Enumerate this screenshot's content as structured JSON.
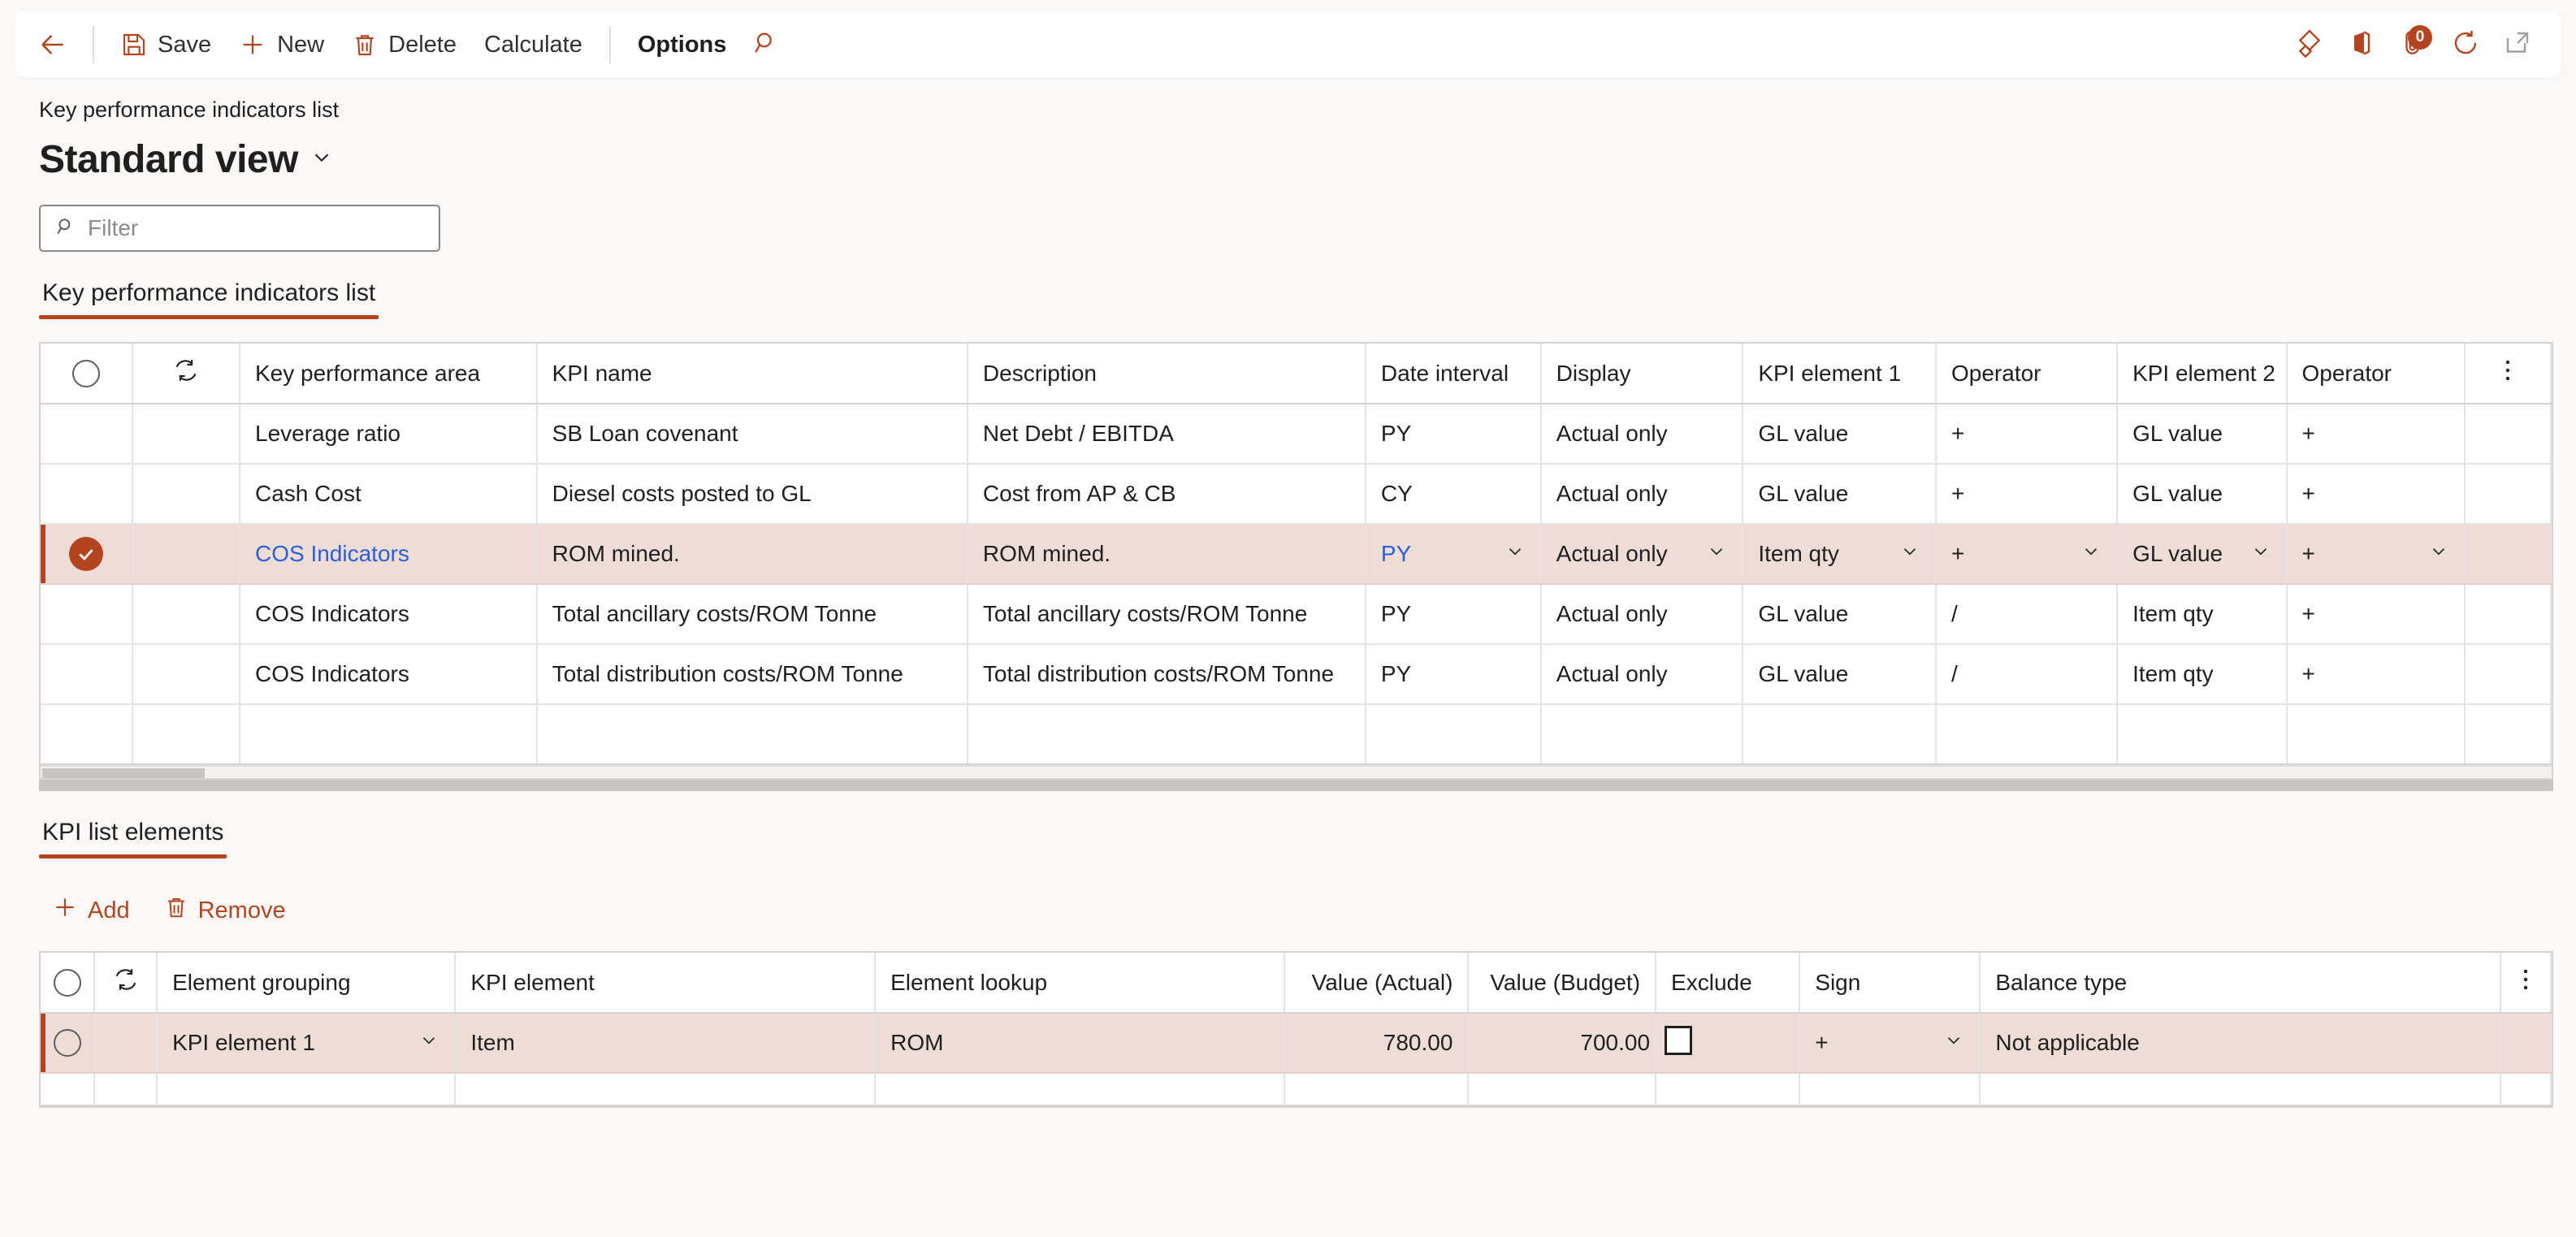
{
  "toolbar": {
    "back_label": "Back",
    "save_label": "Save",
    "new_label": "New",
    "delete_label": "Delete",
    "calculate_label": "Calculate",
    "options_label": "Options",
    "search_label": "Search",
    "icons": {
      "back": "back-arrow-icon",
      "save": "save-icon",
      "new": "plus-icon",
      "delete": "trash-icon",
      "search": "magnifier-icon",
      "diamond": "diamond-app-icon",
      "office": "office-icon",
      "attach": "paperclip-icon",
      "refresh": "refresh-icon",
      "popout": "open-in-new-window-icon"
    },
    "notification_count": "0"
  },
  "header": {
    "breadcrumb": "Key performance indicators list",
    "view_title": "Standard view"
  },
  "filter": {
    "placeholder": "Filter",
    "value": ""
  },
  "section_tabs": {
    "kpi_list": "Key performance indicators list",
    "kpi_elements": "KPI list elements"
  },
  "kpi_grid": {
    "columns": [
      "Key performance area",
      "KPI name",
      "Description",
      "Date interval",
      "Display",
      "KPI element 1",
      "Operator",
      "KPI element 2",
      "Operator"
    ],
    "rows": [
      {
        "selected": false,
        "area": "Leverage ratio",
        "name": "SB Loan covenant",
        "description": "Net Debt / EBITDA",
        "date_interval": "PY",
        "display": "Actual only",
        "element1": "GL value",
        "operator1": "+",
        "element2": "GL value",
        "operator2": "+"
      },
      {
        "selected": false,
        "area": "Cash Cost",
        "name": "Diesel costs posted to GL",
        "description": "Cost from AP & CB",
        "date_interval": "CY",
        "display": "Actual only",
        "element1": "GL value",
        "operator1": "+",
        "element2": "GL value",
        "operator2": "+"
      },
      {
        "selected": true,
        "area": "COS Indicators",
        "name": "ROM mined.",
        "description": "ROM mined.",
        "date_interval": "PY",
        "display": "Actual only",
        "element1": "Item qty",
        "operator1": "+",
        "element2": "GL value",
        "operator2": "+"
      },
      {
        "selected": false,
        "area": "COS Indicators",
        "name": "Total ancillary costs/ROM Tonne",
        "description": "Total ancillary costs/ROM Tonne",
        "date_interval": "PY",
        "display": "Actual only",
        "element1": "GL value",
        "operator1": "/",
        "element2": "Item qty",
        "operator2": "+"
      },
      {
        "selected": false,
        "area": "COS Indicators",
        "name": "Total distribution costs/ROM Tonne",
        "description": "Total distribution costs/ROM Tonne",
        "date_interval": "PY",
        "display": "Actual only",
        "element1": "GL value",
        "operator1": "/",
        "element2": "Item qty",
        "operator2": "+"
      }
    ]
  },
  "elements_actions": {
    "add_label": "Add",
    "remove_label": "Remove"
  },
  "elements_grid": {
    "columns": [
      "Element grouping",
      "KPI element",
      "Element lookup",
      "Value (Actual)",
      "Value (Budget)",
      "Exclude",
      "Sign",
      "Balance type"
    ],
    "rows": [
      {
        "selected": true,
        "grouping": "KPI element 1",
        "element": "Item",
        "lookup": "ROM",
        "value_actual": "780.00",
        "value_budget": "700.00",
        "exclude": false,
        "sign": "+",
        "balance_type": "Not applicable"
      }
    ]
  },
  "colors": {
    "accent": "#b4441f",
    "selected_row": "#eeddd7",
    "link": "#2b5fd9"
  }
}
